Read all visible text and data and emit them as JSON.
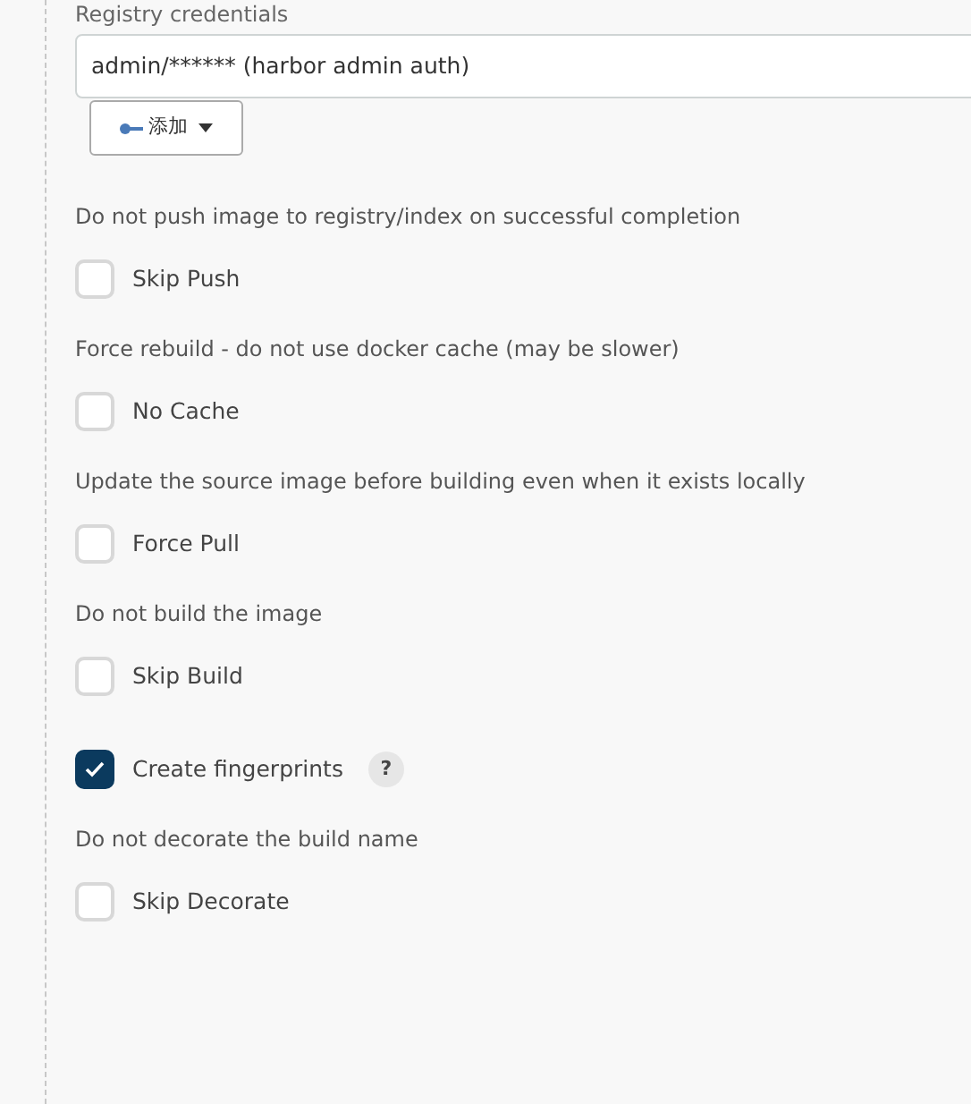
{
  "registry_credentials": {
    "label": "Registry credentials",
    "value": "admin/****** (harbor admin auth)",
    "add_button": "添加"
  },
  "options": [
    {
      "description": "Do not push image to registry/index on successful completion",
      "label": "Skip Push",
      "checked": false
    },
    {
      "description": "Force rebuild - do not use docker cache (may be slower)",
      "label": "No Cache",
      "checked": false
    },
    {
      "description": "Update the source image before building even when it exists locally",
      "label": "Force Pull",
      "checked": false
    },
    {
      "description": "Do not build the image",
      "label": "Skip Build",
      "checked": false
    },
    {
      "label": "Create fingerprints",
      "checked": true,
      "help": "?"
    },
    {
      "description": "Do not decorate the build name",
      "label": "Skip Decorate",
      "checked": false
    }
  ]
}
